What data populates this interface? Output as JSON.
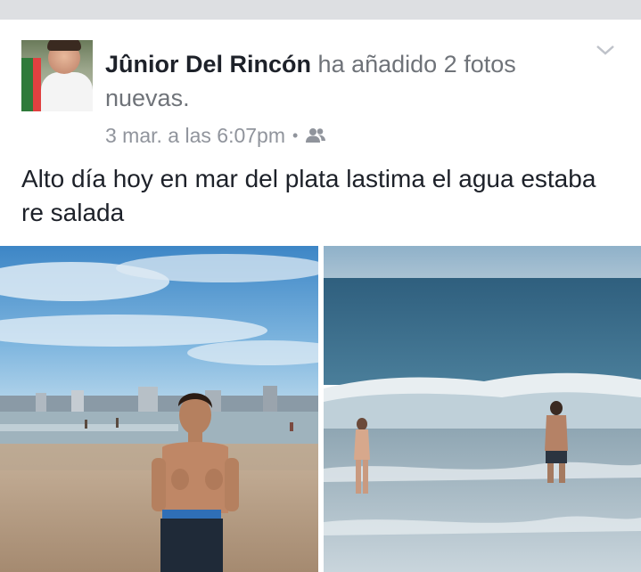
{
  "post": {
    "author": "Jûnior Del Rincón",
    "action": "ha añadido 2 fotos nuevas.",
    "timestamp": "3 mar. a las 6:07pm",
    "separator": "•",
    "audience_icon": "friends-icon",
    "text": "Alto día hoy en mar del plata lastima el agua estaba re salada",
    "menu_icon": "chevron-down-icon",
    "photos": [
      {
        "name": "photo-beach-selfie"
      },
      {
        "name": "photo-ocean-waves"
      }
    ]
  },
  "colors": {
    "background": "#dddfe2",
    "card": "#ffffff",
    "author": "#1d2129",
    "secondary": "#6f7379",
    "meta": "#90949c"
  }
}
